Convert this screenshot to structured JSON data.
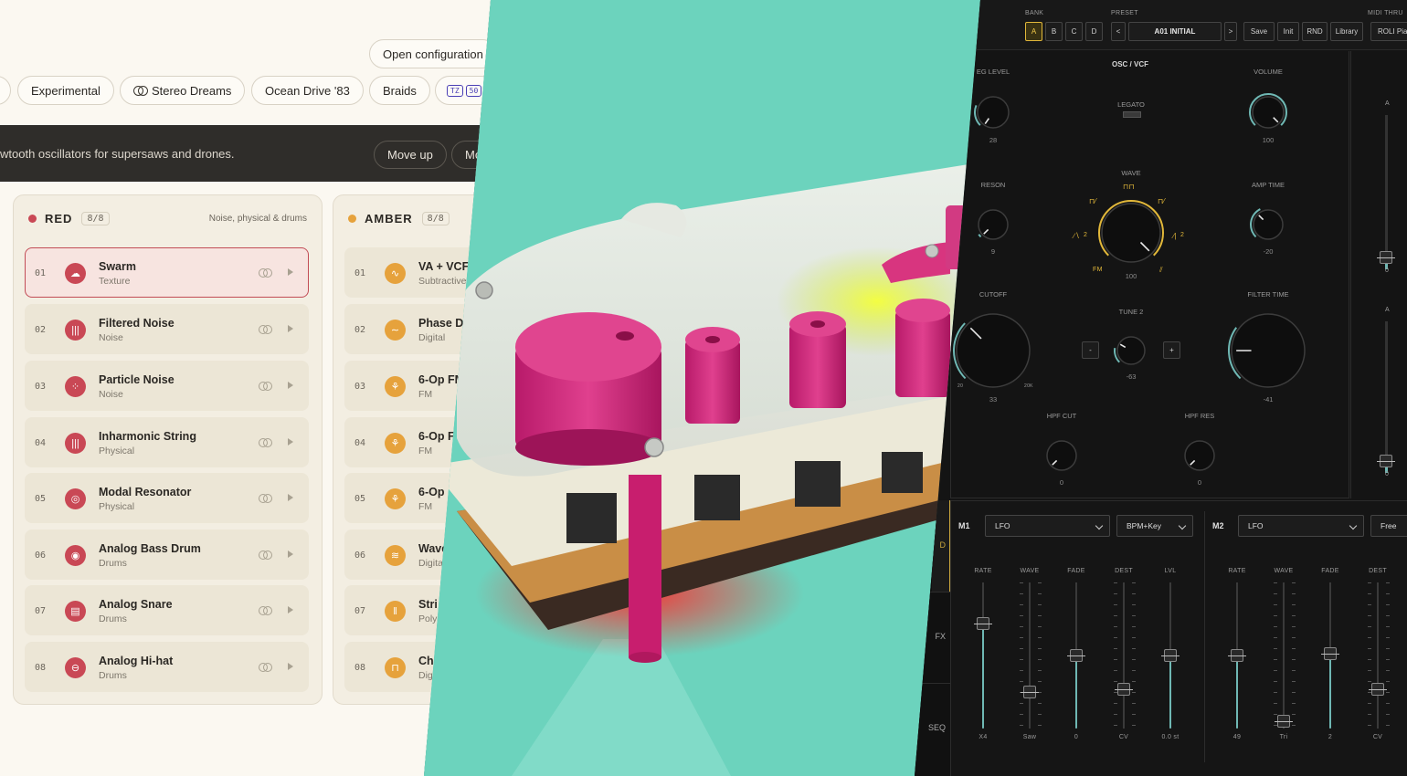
{
  "left_panel": {
    "open_config_label": "Open configuration",
    "chips": [
      {
        "label": "Experimental",
        "icon": ""
      },
      {
        "label": "Stereo Dreams",
        "icon": "link-icon"
      },
      {
        "label": "Ocean Drive '83",
        "icon": ""
      },
      {
        "label": "Braids",
        "icon": ""
      },
      {
        "label": "",
        "icon": "tz-badge-icon",
        "badges": [
          "TZ",
          "50"
        ]
      }
    ],
    "info_text": "wtooth oscillators for supersaws and drones.",
    "move_up_label": "Move up",
    "move_down_label": "Mo",
    "columns": [
      {
        "name": "RED",
        "count": "8/8",
        "subtitle": "Noise, physical & drums",
        "color": "#c94855",
        "items": [
          {
            "num": "01",
            "name": "Swarm",
            "category": "Texture",
            "icon": "cloud-icon",
            "selected": true
          },
          {
            "num": "02",
            "name": "Filtered Noise",
            "category": "Noise",
            "icon": "waveform-icon",
            "selected": false
          },
          {
            "num": "03",
            "name": "Particle Noise",
            "category": "Noise",
            "icon": "particles-icon",
            "selected": false
          },
          {
            "num": "04",
            "name": "Inharmonic String",
            "category": "Physical",
            "icon": "string-icon",
            "selected": false
          },
          {
            "num": "05",
            "name": "Modal Resonator",
            "category": "Physical",
            "icon": "resonator-icon",
            "selected": false
          },
          {
            "num": "06",
            "name": "Analog Bass Drum",
            "category": "Drums",
            "icon": "bass-drum-icon",
            "selected": false
          },
          {
            "num": "07",
            "name": "Analog Snare",
            "category": "Drums",
            "icon": "snare-icon",
            "selected": false
          },
          {
            "num": "08",
            "name": "Analog Hi-hat",
            "category": "Drums",
            "icon": "hihat-icon",
            "selected": false
          }
        ]
      },
      {
        "name": "AMBER",
        "count": "8/8",
        "subtitle": "",
        "color": "#e6a23c",
        "items": [
          {
            "num": "01",
            "name": "VA + VCF",
            "category": "Subtractive",
            "icon": "zigzag-icon"
          },
          {
            "num": "02",
            "name": "Phase D",
            "category": "Digital",
            "icon": "sine-icon"
          },
          {
            "num": "03",
            "name": "6-Op FM",
            "category": "FM",
            "icon": "fm-icon"
          },
          {
            "num": "04",
            "name": "6-Op F",
            "category": "FM",
            "icon": "fm-icon"
          },
          {
            "num": "05",
            "name": "6-Op",
            "category": "FM",
            "icon": "fm-icon"
          },
          {
            "num": "06",
            "name": "Wave",
            "category": "Digita",
            "icon": "waves-icon"
          },
          {
            "num": "07",
            "name": "Stri",
            "category": "Poly",
            "icon": "strings-icon"
          },
          {
            "num": "08",
            "name": "Ch",
            "category": "Dig",
            "icon": "chord-icon"
          }
        ]
      }
    ]
  },
  "synth": {
    "bank_label": "BANK",
    "banks": [
      "A",
      "B",
      "C",
      "D"
    ],
    "active_bank": "A",
    "preset_label": "PRESET",
    "preset_prev": "<",
    "preset_name": "A01 INITIAL",
    "preset_next": ">",
    "actions": [
      "Save",
      "Init",
      "RND",
      "Library"
    ],
    "midi_thru_label": "MIDI THRU",
    "midi_device": "ROLI Pia",
    "section_title": "OSC / VCF",
    "knobs": {
      "eg_level": {
        "label": "EG LEVEL",
        "value": "28"
      },
      "legato": {
        "label": "LEGATO"
      },
      "volume": {
        "label": "VOLUME",
        "value": "100"
      },
      "reson": {
        "label": "RESON",
        "value": "9"
      },
      "wave": {
        "label": "WAVE",
        "value": "100",
        "fm_label": "FM",
        "left_mark": "2",
        "right_mark": "2"
      },
      "amp_time": {
        "label": "AMP TIME",
        "value": "-20"
      },
      "cutoff": {
        "label": "CUTOFF",
        "value": "33",
        "min": "20",
        "max": "20K"
      },
      "tune2": {
        "label": "TUNE 2",
        "value": "-63",
        "minus": "-",
        "plus": "+"
      },
      "filter_time": {
        "label": "FILTER TIME",
        "value": "-41"
      },
      "hpf_cut": {
        "label": "HPF CUT",
        "value": "0"
      },
      "hpf_res": {
        "label": "HPF RES",
        "value": "0"
      }
    },
    "right_sliders": [
      {
        "label": "A",
        "value": "0"
      },
      {
        "label": "A",
        "value": "0"
      }
    ],
    "side_tabs": [
      "D",
      "FX",
      "SEQ"
    ],
    "mod1": {
      "label": "M1",
      "type": "LFO",
      "sync": "BPM+Key",
      "faders": [
        {
          "label": "RATE",
          "value": "X4",
          "level": 0.72
        },
        {
          "label": "WAVE",
          "value": "Saw",
          "level": 0.25
        },
        {
          "label": "FADE",
          "value": "0",
          "level": 0.5
        },
        {
          "label": "DEST",
          "value": "CV",
          "level": 0.27
        },
        {
          "label": "LVL",
          "value": "0.0 st",
          "level": 0.5
        }
      ]
    },
    "mod2": {
      "label": "M2",
      "type": "LFO",
      "sync": "Free",
      "faders": [
        {
          "label": "RATE",
          "value": "49",
          "level": 0.5
        },
        {
          "label": "WAVE",
          "value": "Tri",
          "level": 0.05
        },
        {
          "label": "FADE",
          "value": "2",
          "level": 0.51
        },
        {
          "label": "DEST",
          "value": "CV",
          "level": 0.27
        }
      ]
    }
  }
}
